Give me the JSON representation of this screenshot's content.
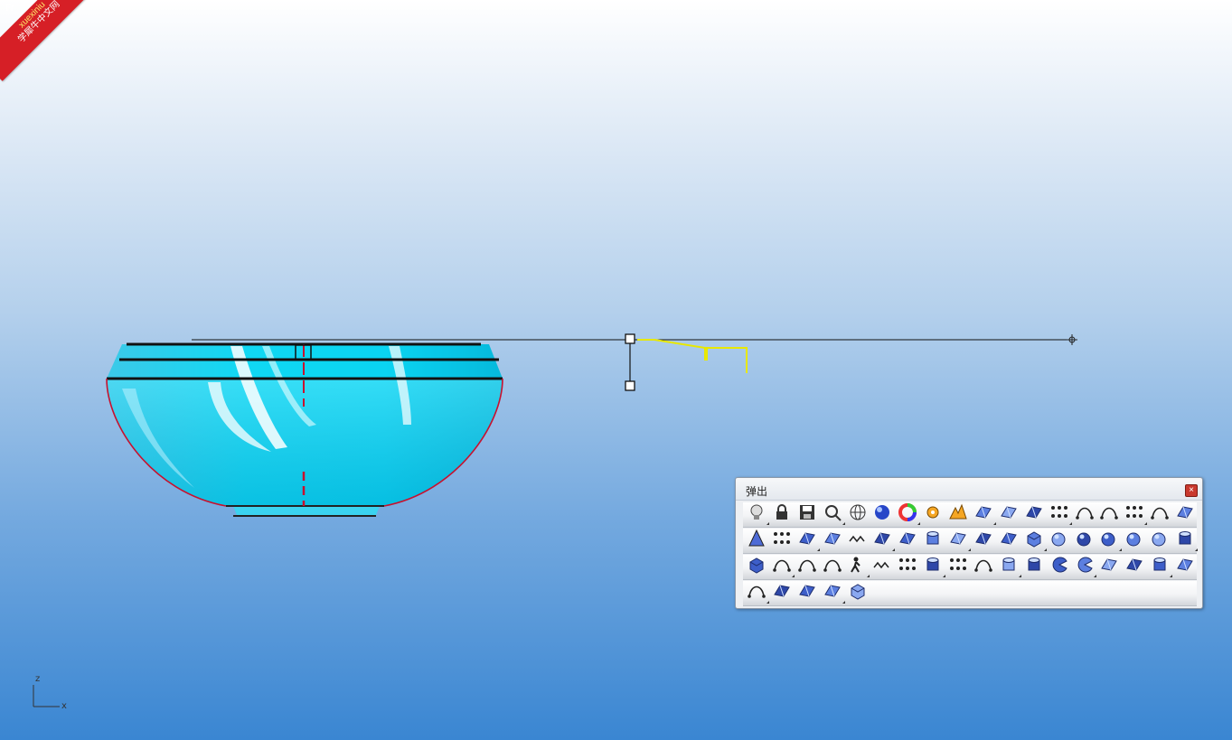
{
  "watermark": {
    "corner_text": "Fr",
    "line1": "xuexiniu",
    "line2": "学犀牛中文网"
  },
  "viewport": {
    "axis_z": "z",
    "axis_x": "x"
  },
  "popup": {
    "title": "弹出",
    "close_label": "×",
    "rows": [
      [
        "light-bulb-icon",
        "lock-icon",
        "save-icon",
        "zoom-extents-icon",
        "wireframe-sphere-icon",
        "shaded-sphere-icon",
        "color-wheel-icon",
        "gear-puzzle-icon",
        "explode-icon",
        "revolve-icon",
        "patch-surface-icon",
        "fold-surface-icon",
        "dots-surface-icon",
        "curve-1-2-icon",
        "curve-1-2b-icon",
        "circle-points-icon",
        "arch-icon",
        "sweep-icon"
      ],
      [
        "tree-icon",
        "node-graph-icon",
        "stack-icon",
        "surface-edge-icon",
        "zigzag-curve-icon",
        "circle-point-icon",
        "layers-icon",
        "cylinder-icon",
        "plane-surface-icon",
        "plane-surface-b-icon",
        "circle-point-b-icon",
        "box-icon",
        "sphere-icon",
        "sphere-pair-icon",
        "sphere-split-icon",
        "sphere-intersect-icon",
        "sphere-numbered-icon",
        "tube-icon"
      ],
      [
        "solid-box-icon",
        "bend-curve-icon",
        "s-curve-icon",
        "arc-curve-icon",
        "person-icon",
        "zigzag-curve-b-icon",
        "column-points-icon",
        "cylinder-solid-icon",
        "grid-points-icon",
        "pipe-bend-icon",
        "stacked-cylinders-icon",
        "cylinder-b-icon",
        "pacman-icon",
        "pacman-b-icon",
        "page-curl-icon",
        "funnel-icon",
        "cylinder-band-icon",
        "twisted-surface-icon"
      ],
      [
        "bend-plane-icon",
        "plane-flat-icon",
        "folded-plane-icon",
        "twisted-strip-icon",
        "book-icon"
      ]
    ]
  }
}
